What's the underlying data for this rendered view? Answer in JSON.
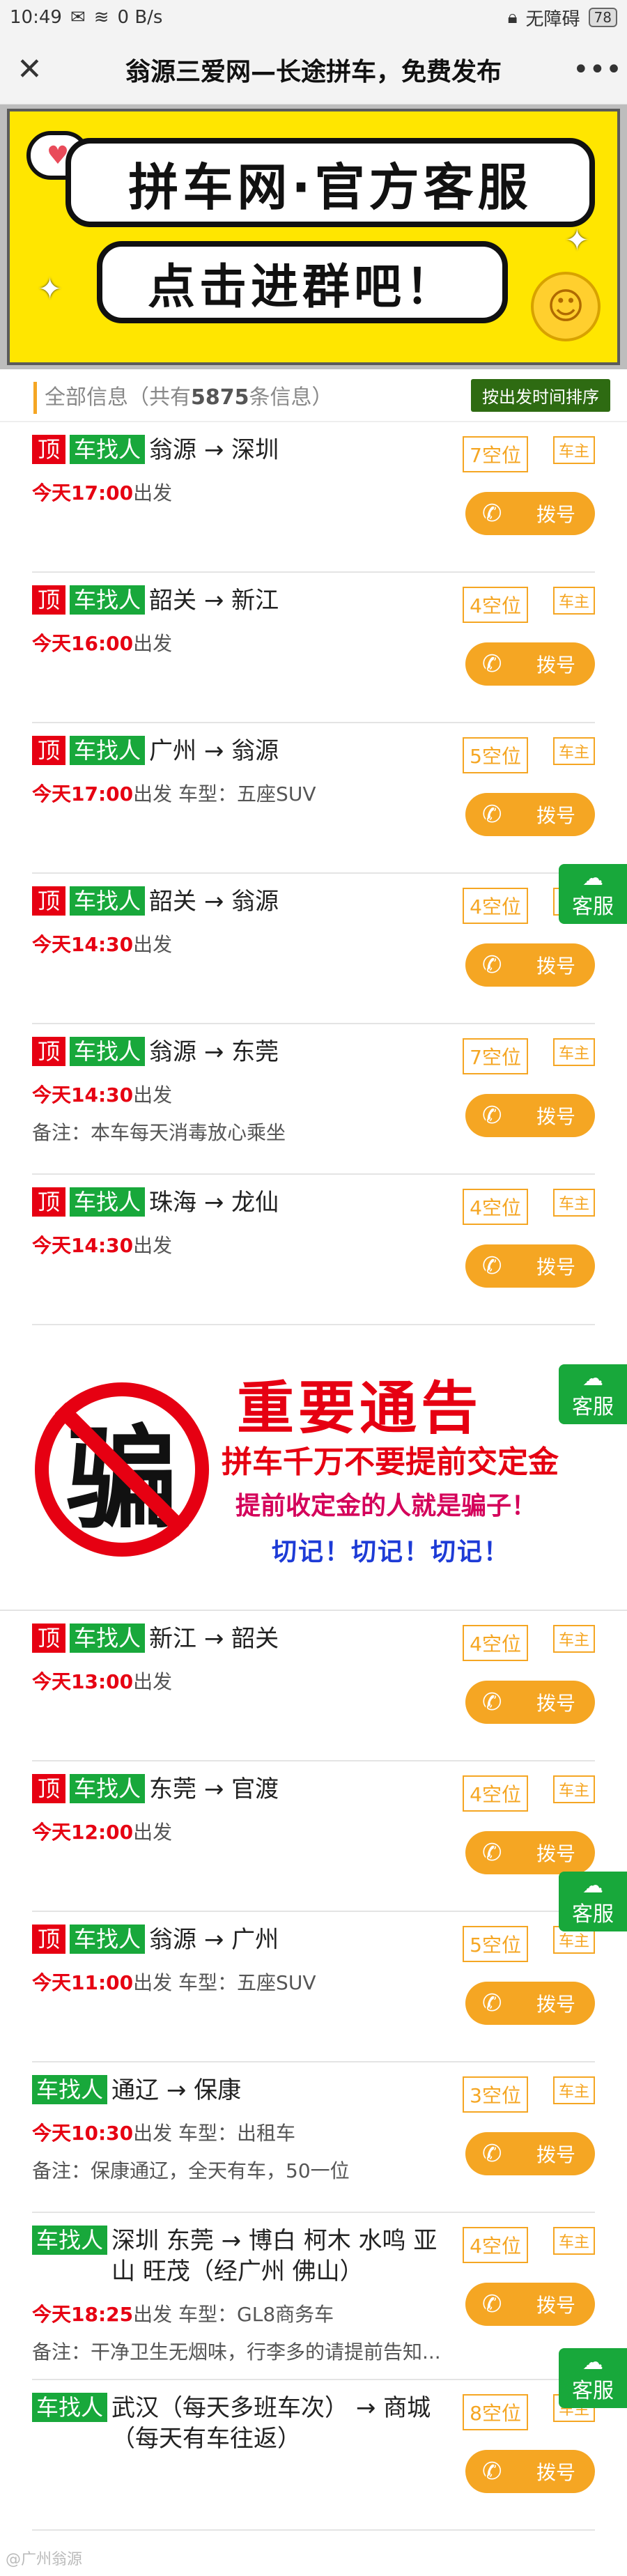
{
  "status": {
    "time": "10:49",
    "net_speed": "0 B/s",
    "accessibility": "无障碍",
    "battery": "78"
  },
  "nav": {
    "title": "翁源三爱网—长途拼车，免费发布",
    "close": "✕",
    "more": "•••"
  },
  "banner": {
    "top_text": "拼车网·官方客服",
    "bottom_text": "点击进群吧！"
  },
  "summary": {
    "prefix": "全部信息（共有",
    "count": "5875",
    "suffix": "条信息）",
    "sort_label": "按出发时间排序"
  },
  "labels": {
    "top": "顶",
    "type": "车找人",
    "depart_suffix": "出发",
    "owner": "车主",
    "dial": "拨号",
    "service": "客服"
  },
  "rides_a": [
    {
      "top": true,
      "route": "翁源 → 深圳",
      "time": "今天17:00",
      "extra": "",
      "note": "",
      "seats": "7空位"
    },
    {
      "top": true,
      "route": "韶关 → 新江",
      "time": "今天16:00",
      "extra": "",
      "note": "",
      "seats": "4空位"
    },
    {
      "top": true,
      "route": "广州 → 翁源",
      "time": "今天17:00",
      "extra": " 车型：五座SUV",
      "note": "",
      "seats": "5空位"
    },
    {
      "top": true,
      "route": "韶关 → 翁源",
      "time": "今天14:30",
      "extra": "",
      "note": "",
      "seats": "4空位"
    },
    {
      "top": true,
      "route": "翁源 → 东莞",
      "time": "今天14:30",
      "extra": "",
      "note": "备注：本车每天消毒放心乘坐",
      "seats": "7空位"
    },
    {
      "top": true,
      "route": "珠海 → 龙仙",
      "time": "今天14:30",
      "extra": "",
      "note": "",
      "seats": "4空位"
    }
  ],
  "warning": {
    "icon_char": "骗",
    "title": "重要通告",
    "line1": "拼车千万不要提前交定金",
    "line2": "提前收定金的人就是骗子！",
    "line3": "切记！切记！切记！"
  },
  "rides_b": [
    {
      "top": true,
      "route": "新江 → 韶关",
      "time": "今天13:00",
      "extra": "",
      "note": "",
      "seats": "4空位"
    },
    {
      "top": true,
      "route": "东莞 → 官渡",
      "time": "今天12:00",
      "extra": "",
      "note": "",
      "seats": "4空位"
    },
    {
      "top": true,
      "route": "翁源 → 广州",
      "time": "今天11:00",
      "extra": " 车型：五座SUV",
      "note": "",
      "seats": "5空位"
    },
    {
      "top": false,
      "route": "通辽 → 保康",
      "time": "今天10:30",
      "extra": " 车型：出租车",
      "note": "备注：保康通辽，全天有车，50一位",
      "seats": "3空位"
    },
    {
      "top": false,
      "route": "深圳 东莞 → 博白 柯木 水鸣 亚山 旺茂（经广州 佛山）",
      "time": "今天18:25",
      "extra": " 车型：GL8商务车",
      "note": "备注：干净卫生无烟味，行李多的请提前告知...",
      "seats": "4空位"
    },
    {
      "top": false,
      "route": "武汉（每天多班车次） → 商城（每天有车往返）",
      "time": "",
      "extra": "",
      "note": "",
      "seats": "8空位"
    }
  ],
  "watermark": "@广州翁源"
}
